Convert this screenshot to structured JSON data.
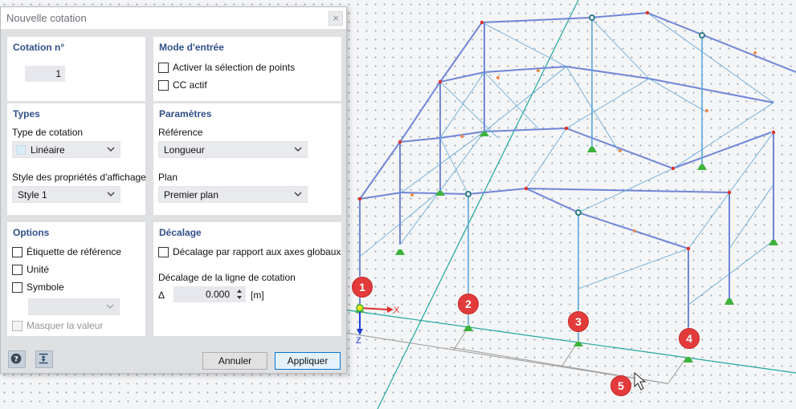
{
  "dialog": {
    "title": "Nouvelle cotation",
    "close_glyph": "×"
  },
  "panels": {
    "number": {
      "title": "Cotation n°",
      "value": "1"
    },
    "input_mode": {
      "title": "Mode d'entrée",
      "activate_points": "Activer la sélection de points",
      "cc_active": "CC actif"
    },
    "types": {
      "title": "Types",
      "dim_type_label": "Type de cotation",
      "dim_type_value": "Linéaire",
      "style_label": "Style des propriétés d'affichage",
      "style_value": "Style 1"
    },
    "params": {
      "title": "Paramètres",
      "reference_label": "Référence",
      "reference_value": "Longueur",
      "plane_label": "Plan",
      "plane_value": "Premier plan"
    },
    "options": {
      "title": "Options",
      "reference_tag": "Étiquette de référence",
      "unit": "Unité",
      "symbol": "Symbole",
      "hide_value": "Masquer la valeur"
    },
    "offset": {
      "title": "Décalage",
      "global_axes": "Décalage par rapport aux axes globaux",
      "line_offset_label": "Décalage de la ligne de cotation",
      "delta_symbol": "Δ",
      "delta_value": "0.000",
      "unit": "[m]"
    }
  },
  "footer": {
    "cancel": "Annuler",
    "apply": "Appliquer",
    "help_icon": "help-icon",
    "pick_icon": "dimension-pick-icon"
  },
  "viewport": {
    "axis_x": "X",
    "axis_z": "Z",
    "markers": [
      "1",
      "2",
      "3",
      "4",
      "5"
    ]
  },
  "colors": {
    "panel_title": "#2f4f8a",
    "member": "#6f86d8",
    "bracing": "#5aa6d8",
    "support": "#3db33d",
    "node": "#e0312b",
    "marker": "#e33b3b",
    "grid_line": "#1fa7a0"
  }
}
